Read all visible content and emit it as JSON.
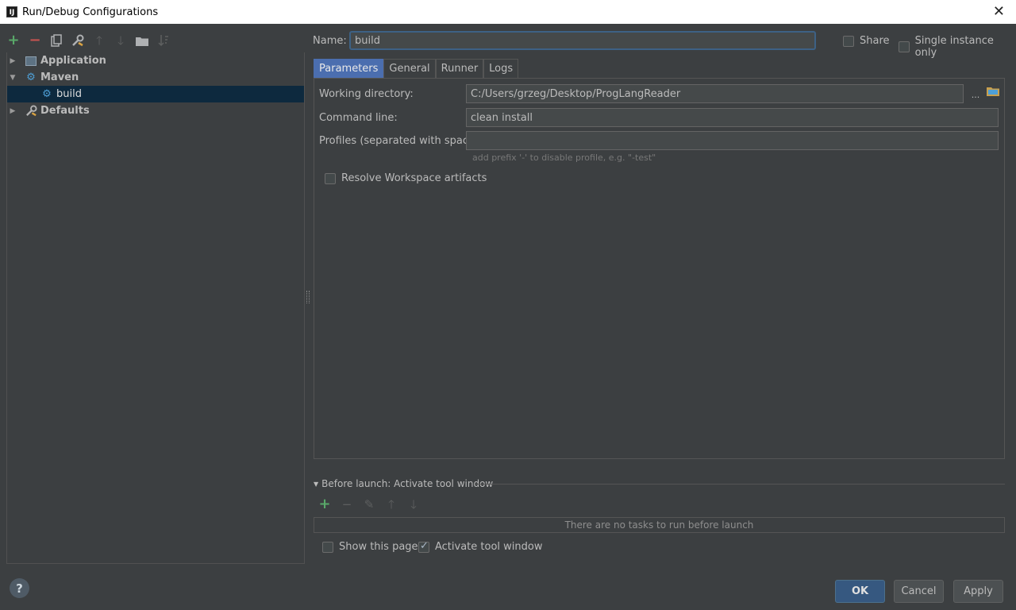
{
  "window": {
    "title": "Run/Debug Configurations",
    "app_icon_text": "IJ",
    "close_glyph": "✕"
  },
  "left_toolbar": {
    "icons": [
      "add-icon",
      "remove-icon",
      "copy-icon",
      "edit-defaults-icon",
      "move-up-icon",
      "move-down-icon",
      "folder-icon",
      "sort-icon"
    ]
  },
  "tree": {
    "items": [
      {
        "label": "Application",
        "expanded": false,
        "icon": "application-icon"
      },
      {
        "label": "Maven",
        "expanded": true,
        "icon": "maven-gear-icon"
      },
      {
        "label": "build",
        "selected": true,
        "icon": "maven-gear-icon"
      },
      {
        "label": "Defaults",
        "expanded": false,
        "icon": "wrench-icon"
      }
    ]
  },
  "config": {
    "name_label": "Name:",
    "name_value": "build",
    "share_label": "Share",
    "share_checked": false,
    "single_instance_label": "Single instance only",
    "single_instance_checked": false
  },
  "tabs": [
    {
      "label": "Parameters",
      "active": true
    },
    {
      "label": "General",
      "active": false
    },
    {
      "label": "Runner",
      "active": false
    },
    {
      "label": "Logs",
      "active": false
    }
  ],
  "parameters": {
    "working_dir_label": "Working directory:",
    "working_dir_value": "C:/Users/grzeg/Desktop/ProgLangReader",
    "browse_label": "...",
    "command_line_label": "Command line:",
    "command_line_value": "clean install",
    "profiles_label": "Profiles (separated with space):",
    "profiles_value": "",
    "profiles_hint": "add prefix '-' to disable profile, e.g. \"-test\"",
    "resolve_label": "Resolve Workspace artifacts",
    "resolve_checked": false
  },
  "before_launch": {
    "title": "Before launch: Activate tool window",
    "empty_text": "There are no tasks to run before launch",
    "show_page_label": "Show this page",
    "show_page_checked": false,
    "activate_label": "Activate tool window",
    "activate_checked": true
  },
  "buttons": {
    "help": "?",
    "ok": "OK",
    "cancel": "Cancel",
    "apply": "Apply"
  },
  "colors": {
    "background": "#3c3f41",
    "selection": "#0d293e",
    "tab_active": "#4b6eaf",
    "primary_button": "#365880",
    "add_green": "#59a869",
    "remove_red": "#c75450",
    "maven_blue": "#4e9fd6"
  }
}
